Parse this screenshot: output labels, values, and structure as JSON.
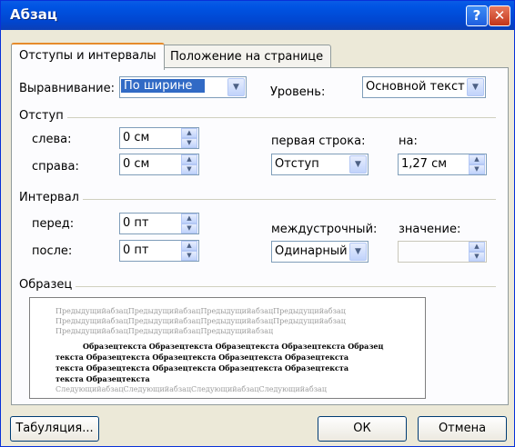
{
  "window": {
    "title": "Абзац",
    "help_glyph": "?",
    "close_glyph": "✕"
  },
  "tabs": [
    {
      "label": "Отступы и интервалы"
    },
    {
      "label": "Положение на странице"
    }
  ],
  "alignment": {
    "label": "Выравнивание:",
    "value": "По ширине"
  },
  "level": {
    "label": "Уровень:",
    "value": "Основной текст"
  },
  "indent": {
    "group_title": "Отступ",
    "left_label": "слева:",
    "left_value": "0 см",
    "right_label": "справа:",
    "right_value": "0 см",
    "first_line_label": "первая строка:",
    "first_line_value": "Отступ",
    "by_label": "на:",
    "by_value": "1,27 см"
  },
  "spacing": {
    "group_title": "Интервал",
    "before_label": "перед:",
    "before_value": "0 пт",
    "after_label": "после:",
    "after_value": "0 пт",
    "line_label": "междустрочный:",
    "line_value": "Одинарный",
    "at_label": "значение:",
    "at_value": ""
  },
  "preview": {
    "group_title": "Образец",
    "prev_lines": [
      "ПредыдущийабзацПредыдущийабзацПредыдущийабзацПредыдущийабзац",
      "ПредыдущийабзацПредыдущийабзацПредыдущийабзацПредыдущийабзац",
      "ПредыдущийабзацПредыдущийабзацПредыдущийабзац"
    ],
    "sample_lines": [
      "Образецтекста Образецтекста Образецтекста Образецтекста Образец",
      "текста Образецтекста Образецтекста Образецтекста Образецтекста",
      "текста Образецтекста Образецтекста Образецтекста Образецтекста",
      "текста Образецтекста"
    ],
    "next_line": "СледующийабзацСледующийабзацСледующийабзацСледующийабзац"
  },
  "buttons": {
    "tabs": "Табуляция...",
    "ok": "ОК",
    "cancel": "Отмена"
  },
  "icons": {
    "up": "▲",
    "down": "▼"
  }
}
